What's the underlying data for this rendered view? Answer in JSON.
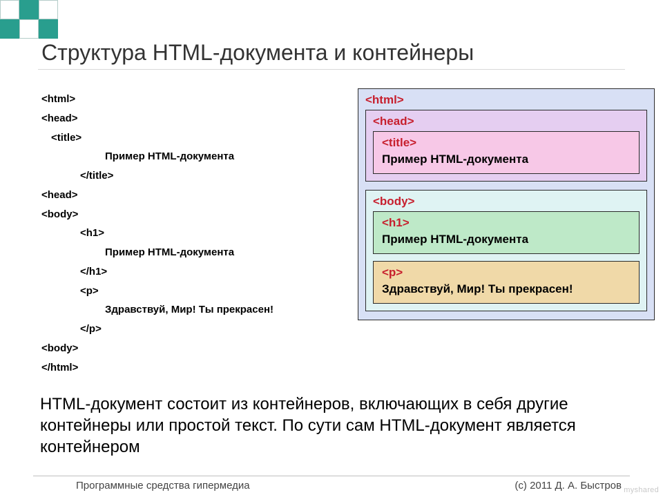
{
  "title": "Структура HTML-документа и контейнеры",
  "code": {
    "l1": "<html>",
    "l2": "<head>",
    "l3": "<title>",
    "l4": "Пример HTML-документа",
    "l5": "</title>",
    "l6": "<head>",
    "l7": "<body>",
    "l8": "<h1>",
    "l9": "Пример HTML-документа",
    "l10": "</h1>",
    "l11": "<p>",
    "l12": "Здравствуй, Мир! Ты прекрасен!",
    "l13": "</p>",
    "l14": "<body>",
    "l15": "</html>"
  },
  "diagram": {
    "html_tag": "<html>",
    "head_tag": "<head>",
    "title_tag": "<title>",
    "title_text": "Пример HTML-документа",
    "body_tag": "<body>",
    "h1_tag": "<h1>",
    "h1_text": "Пример HTML-документа",
    "p_tag": "<p>",
    "p_text": "Здравствуй, Мир! Ты прекрасен!"
  },
  "paragraph": "HTML-документ состоит из контейнеров, включающих в себя другие контейнеры или простой текст. По сути сам HTML-документ является контейнером",
  "footer": {
    "left": "Программные средства гипермедиа",
    "right": "(с) 2011    Д. А. Быстров"
  },
  "watermark": "myshared"
}
